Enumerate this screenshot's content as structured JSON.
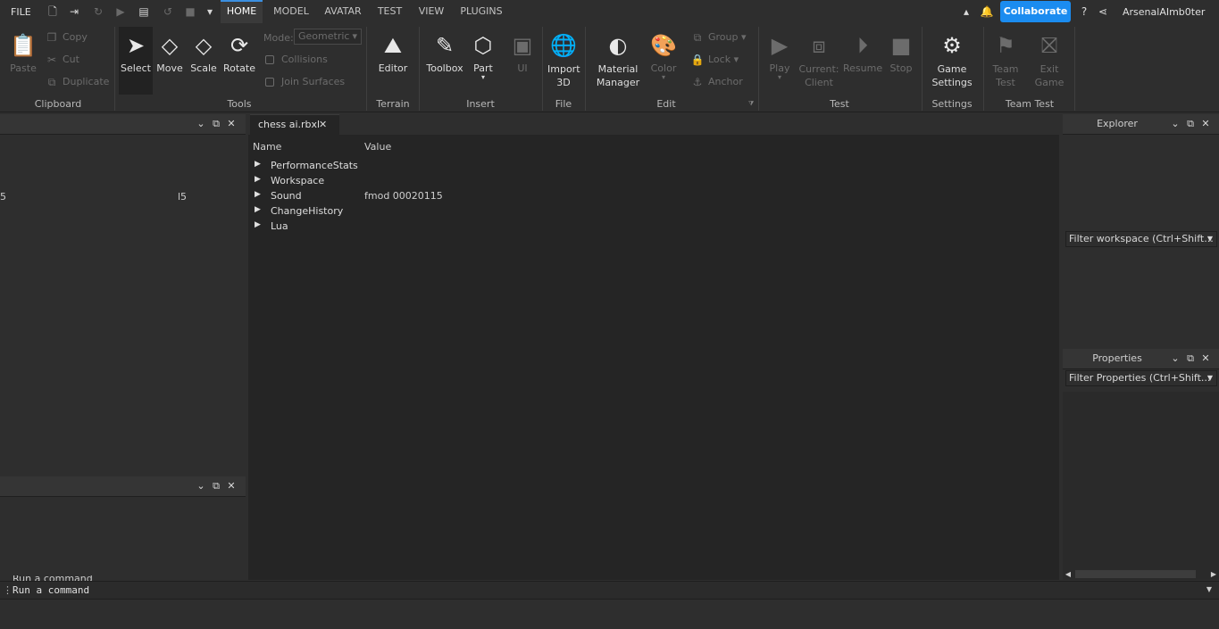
{
  "menubar": {
    "file": "FILE",
    "tabs": [
      "HOME",
      "MODEL",
      "AVATAR",
      "TEST",
      "VIEW",
      "PLUGINS"
    ],
    "collaborate": "Collaborate",
    "username": "ArsenalAImb0ter"
  },
  "ribbon": {
    "clipboard": {
      "paste": "Paste",
      "copy": "Copy",
      "cut": "Cut",
      "duplicate": "Duplicate",
      "label": "Clipboard"
    },
    "tools": {
      "select": "Select",
      "move": "Move",
      "scale": "Scale",
      "rotate": "Rotate",
      "mode_label": "Mode:",
      "mode_value": "Geometric",
      "collisions": "Collisions",
      "join_surfaces": "Join Surfaces",
      "label": "Tools"
    },
    "terrain": {
      "editor": "Editor",
      "label": "Terrain"
    },
    "insert": {
      "toolbox": "Toolbox",
      "part": "Part",
      "ui": "UI",
      "label": "Insert"
    },
    "file": {
      "import_3d": "Import 3D",
      "label": "File"
    },
    "edit": {
      "material_manager": "Material Manager",
      "color": "Color",
      "group": "Group",
      "lock": "Lock",
      "anchor": "Anchor",
      "label": "Edit"
    },
    "test": {
      "play": "Play",
      "current_client": "Current: Client",
      "resume": "Resume",
      "stop": "Stop",
      "label": "Test"
    },
    "settings": {
      "game_settings": "Game Settings",
      "label": "Settings"
    },
    "team_test": {
      "team_test": "Team Test",
      "exit_game": "Exit Game",
      "label": "Team Test"
    }
  },
  "left_panel": {
    "stat_left": "5",
    "stat_right": "l5"
  },
  "document": {
    "tab": "chess ai.rbxl",
    "columns": {
      "name": "Name",
      "value": "Value"
    },
    "rows": [
      {
        "name": "PerformanceStats",
        "value": ""
      },
      {
        "name": "Workspace",
        "value": ""
      },
      {
        "name": "Sound",
        "value": "fmod 00020115"
      },
      {
        "name": "ChangeHistory",
        "value": ""
      },
      {
        "name": "Lua",
        "value": ""
      }
    ]
  },
  "explorer": {
    "title": "Explorer",
    "filter": "Filter workspace (Ctrl+Shift..."
  },
  "properties": {
    "title": "Properties",
    "filter": "Filter Properties (Ctrl+Shift..."
  },
  "command_bar": {
    "placeholder": "Run a command"
  },
  "colors": {
    "accent": "#1b8cf0",
    "background": "#2e2e2e",
    "document": "#252525"
  }
}
